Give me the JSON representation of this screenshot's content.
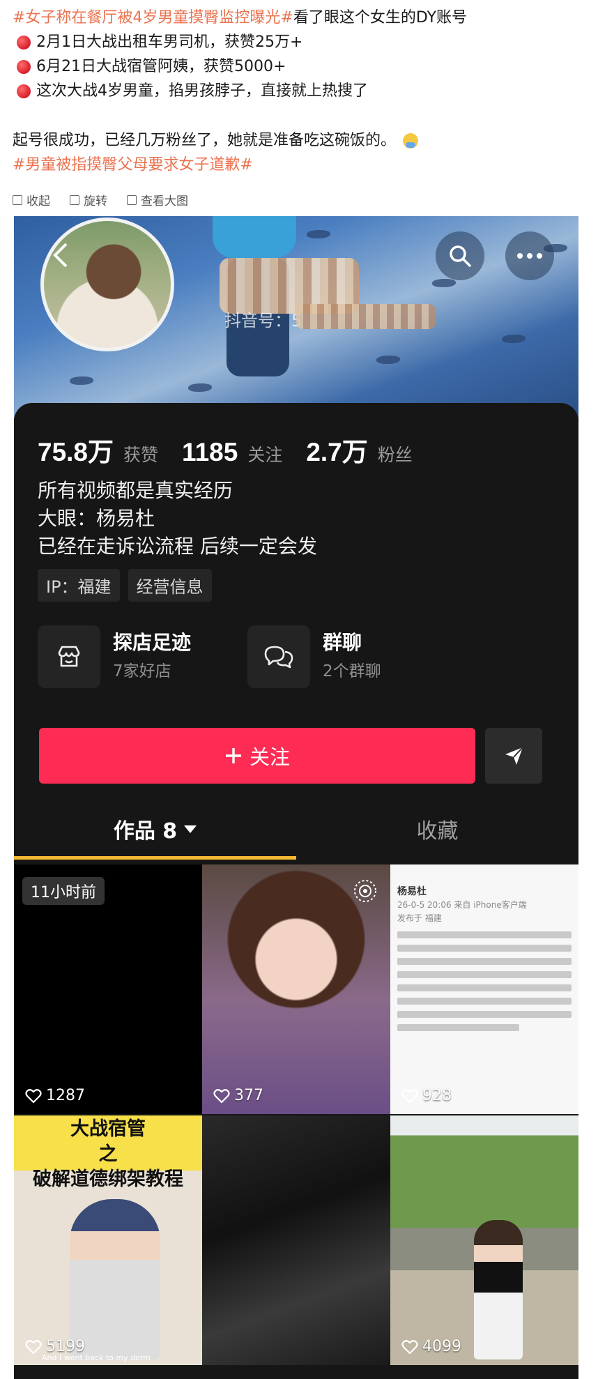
{
  "post": {
    "hashtag1": "#女子称在餐厅被4岁男童摸臀监控曝光#",
    "line1_text": "看了眼这个女生的DY账号",
    "items": [
      "2月1日大战出租车男司机，获赞25万+",
      "6月21日大战宿管阿姨，获赞5000+",
      "这次大战4岁男童，掐男孩脖子，直接就上热搜了"
    ],
    "paragraph": "起号很成功，已经几万粉丝了，她就是准备吃这碗饭的。",
    "hashtag2": "#男童被指摸臀父母要求女子道歉#"
  },
  "tools": {
    "collapse": "收起",
    "rotate": "旋转",
    "view_large": "查看大图"
  },
  "profile": {
    "douyin_id_label": "抖音号：5",
    "stats": [
      {
        "value": "75.8万",
        "label": "获赞"
      },
      {
        "value": "1185",
        "label": "关注"
      },
      {
        "value": "2.7万",
        "label": "粉丝"
      }
    ],
    "bio": [
      "所有视频都是真实经历",
      "大眼：杨易杜",
      "已经在走诉讼流程 后续一定会发"
    ],
    "tags": [
      "IP：福建",
      "经营信息"
    ],
    "shop_card": {
      "title": "探店足迹",
      "sub": "7家好店"
    },
    "group_card": {
      "title": "群聊",
      "sub": "2个群聊"
    },
    "follow_label": "关注",
    "tabs": {
      "works": "作品 8",
      "favorites": "收藏"
    }
  },
  "videos": [
    {
      "likes": "1287",
      "badge": "11小时前"
    },
    {
      "likes": "377"
    },
    {
      "likes": "928",
      "doc_author": "杨易杜",
      "doc_meta": "26-0-5 20:06 来自 iPhone客户端",
      "doc_loc": "发布于 福建"
    },
    {
      "likes": "5199",
      "caption": "大战宿管\n之\n破解道德绑架教程",
      "subtitle": "And I went back to my dorm"
    },
    {
      "likes": ""
    },
    {
      "likes": "4099"
    }
  ],
  "colors": {
    "hashtag": "#eb7350",
    "follow_button": "#fe2c55",
    "tab_indicator": "#f5b932",
    "panel_bg": "#161616"
  }
}
